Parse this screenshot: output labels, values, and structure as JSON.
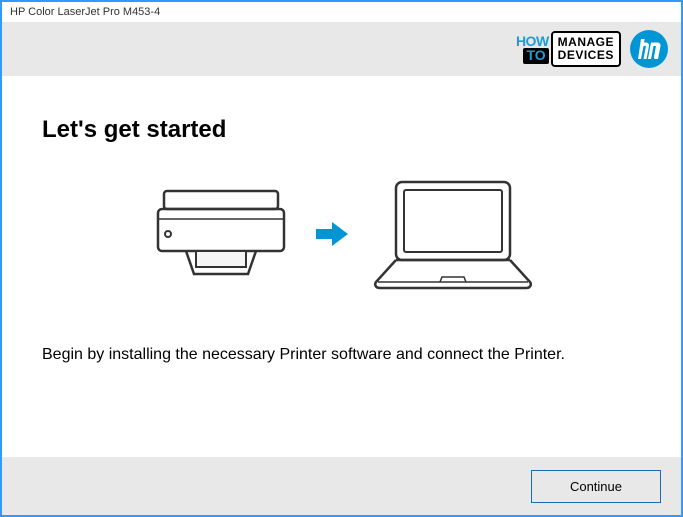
{
  "window": {
    "title": "HP Color LaserJet Pro M453-4"
  },
  "watermark": {
    "how": "HOW",
    "to": "TO",
    "manage": "MANAGE",
    "devices": "DEVICES"
  },
  "brand": {
    "name": "hp"
  },
  "main": {
    "heading": "Let's get started",
    "description": "Begin by installing the necessary Printer software and connect the Printer."
  },
  "footer": {
    "continue_label": "Continue"
  }
}
